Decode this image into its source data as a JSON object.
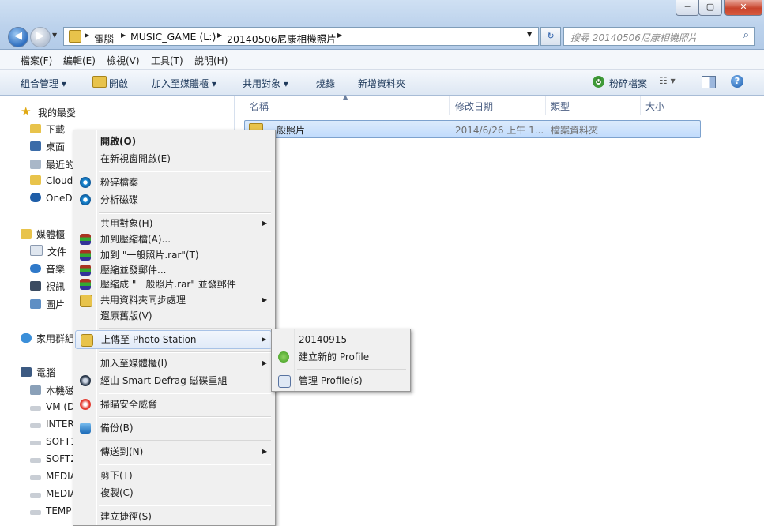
{
  "window": {
    "caption_buttons": [
      "─",
      "▢",
      "✕"
    ],
    "address": {
      "crumbs": [
        "電腦",
        "MUSIC_GAME (L:)",
        "20140506尼康相機照片"
      ]
    },
    "search_placeholder": "搜尋 20140506尼康相機照片"
  },
  "menubar": [
    "檔案(F)",
    "編輯(E)",
    "檢視(V)",
    "工具(T)",
    "說明(H)"
  ],
  "commandbar": {
    "organize": "組合管理 ▾",
    "open": "開啟",
    "add_to_library": "加入至媒體櫃 ▾",
    "share_with": "共用對象 ▾",
    "burn": "燒錄",
    "new_folder": "新增資料夾",
    "shred": "粉碎檔案"
  },
  "navpane": {
    "favorites_header": "我的最愛",
    "favorites": [
      "下載",
      "桌面",
      "最近的",
      "Cloud",
      "OneD"
    ],
    "libraries_header": "媒體櫃",
    "libraries": [
      "文件",
      "音樂",
      "視訊",
      "圖片"
    ],
    "homegroup": "家用群組",
    "computer_header": "電腦",
    "drives": [
      "本機磁",
      "VM (D",
      "INTER",
      "SOFT1",
      "SOFT2",
      "MEDIA",
      "MEDIA",
      "TEMP"
    ]
  },
  "columns": [
    "名稱",
    "修改日期",
    "類型",
    "大小"
  ],
  "files": [
    {
      "name": "一般照片",
      "modified": "2014/6/26 上午 1...",
      "type": "檔案資料夾",
      "size": ""
    }
  ],
  "context_menu": {
    "open": "開啟(O)",
    "open_new_window": "在新視窗開啟(E)",
    "shred": "粉碎檔案",
    "analyze_disk": "分析磁碟",
    "share_with": "共用對象(H)",
    "add_archive": "加到壓縮檔(A)...",
    "add_rar": "加到 \"一般照片.rar\"(T)",
    "compress_email": "壓縮並發郵件...",
    "compress_rar_email": "壓縮成 \"一般照片.rar\" 並發郵件",
    "shared_folder_sync": "共用資料夾同步處理",
    "restore_versions": "還原舊版(V)",
    "upload_photo_station": "上傳至 Photo Station",
    "include_library": "加入至媒體櫃(I)",
    "smart_defrag": "經由 Smart Defrag 磁碟重組",
    "scan_threats": "掃瞄安全威脅",
    "backup": "備份(B)",
    "send_to": "傳送到(N)",
    "cut": "剪下(T)",
    "copy": "複製(C)",
    "create_shortcut": "建立捷徑(S)"
  },
  "submenu": {
    "profile": "20140915",
    "new_profile": "建立新的 Profile",
    "manage_profiles": "管理 Profile(s)"
  }
}
